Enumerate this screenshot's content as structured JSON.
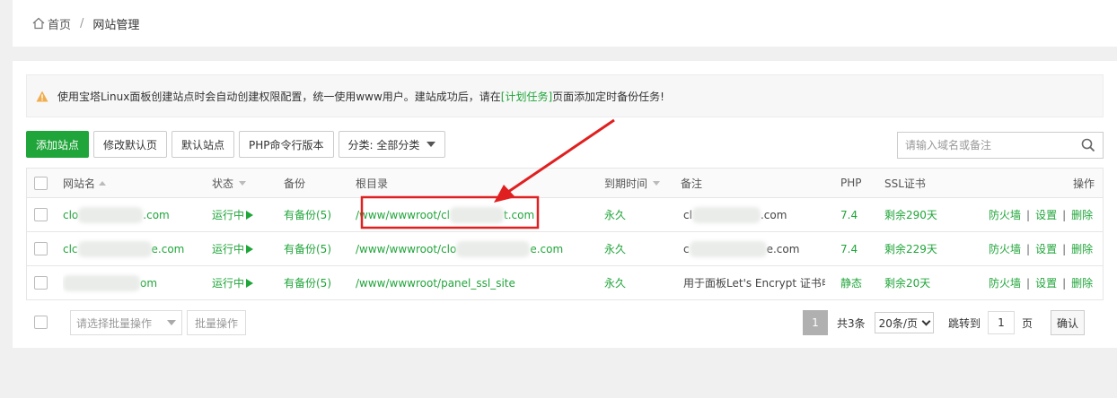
{
  "breadcrumb": {
    "home": "首页",
    "separator": "/",
    "current": "网站管理"
  },
  "notice": {
    "prefix": "使用宝塔Linux面板创建站点时会自动创建权限配置，统一使用www用户。建站成功后，请在",
    "link": "[计划任务]",
    "suffix": "页面添加定时备份任务!"
  },
  "toolbar": {
    "add_site": "添加站点",
    "edit_default_page": "修改默认页",
    "default_site": "默认站点",
    "php_cli_version": "PHP命令行版本",
    "category_select": "分类: 全部分类"
  },
  "search": {
    "placeholder": "请输入域名或备注"
  },
  "table": {
    "headers": {
      "name": "网站名",
      "status": "状态",
      "backup": "备份",
      "root": "根目录",
      "expire": "到期时间",
      "remark": "备注",
      "php": "PHP",
      "ssl": "SSL证书",
      "actions": "操作"
    },
    "rows": [
      {
        "name_prefix": "clo",
        "name_suffix": ".com",
        "status": "运行中",
        "backup": "有备份(5)",
        "root_prefix": "/www/wwwroot/cl",
        "root_suffix": "t.com",
        "expire": "永久",
        "remark_prefix": "cl",
        "remark_suffix": ".com",
        "php": "7.4",
        "ssl": "剩余290天",
        "firewall": "防火墙",
        "settings": "设置",
        "delete": "删除"
      },
      {
        "name_prefix": "clc",
        "name_suffix": "e.com",
        "status": "运行中",
        "backup": "有备份(5)",
        "root_prefix": "/www/wwwroot/clo",
        "root_suffix": "e.com",
        "expire": "永久",
        "remark_prefix": "c",
        "remark_suffix": "e.com",
        "php": "7.4",
        "ssl": "剩余229天",
        "firewall": "防火墙",
        "settings": "设置",
        "delete": "删除"
      },
      {
        "name_prefix": "",
        "name_suffix": "om",
        "status": "运行中",
        "backup": "有备份(5)",
        "root_prefix": "/www/wwwroot/panel_ssl_site",
        "root_suffix": "",
        "expire": "永久",
        "remark_prefix": "用于面板Let's Encrypt 证书申",
        "remark_suffix": "",
        "php": "静态",
        "ssl": "剩余20天",
        "firewall": "防火墙",
        "settings": "设置",
        "delete": "删除"
      }
    ]
  },
  "footer": {
    "batch_placeholder": "请选择批量操作",
    "batch_button": "批量操作",
    "current_page": "1",
    "total": "共3条",
    "page_size": "20条/页",
    "jump_label": "跳转到",
    "jump_value": "1",
    "page_unit": "页",
    "confirm": "确认"
  },
  "colors": {
    "accent": "#20a53a",
    "highlight": "#e02020"
  }
}
